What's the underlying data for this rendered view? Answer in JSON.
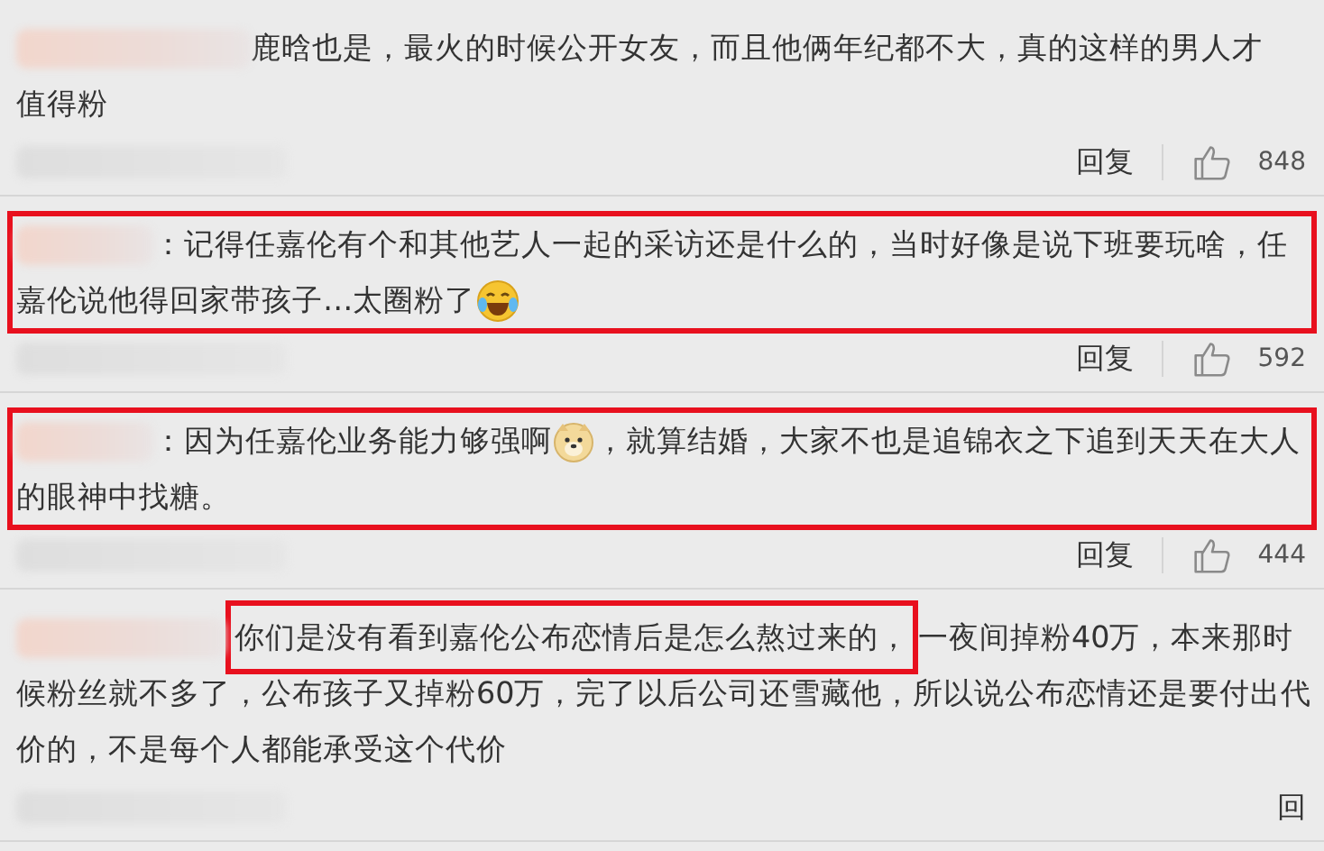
{
  "comments": [
    {
      "highlighted": false,
      "lines": [
        [
          {
            "kind": "text",
            "text": "鹿晗也是，最火的时候公开女友，而且他俩年纪都不大，真的这样的男人才",
            "highlighted": false
          }
        ],
        [
          {
            "kind": "text",
            "text": "值得粉",
            "highlighted": false
          }
        ]
      ],
      "reply": "回复",
      "likes": "848"
    },
    {
      "highlighted": true,
      "lines": [
        [
          {
            "kind": "text",
            "text": "：记得任嘉伦有个和其他艺人一起的采访还是什么的，当时好像是说下班要玩啥，任",
            "highlighted": false
          }
        ],
        [
          {
            "kind": "text",
            "text": "嘉伦说他得回家带孩子…太圈粉了",
            "highlighted": false
          },
          {
            "kind": "laughemoji"
          }
        ]
      ],
      "reply": "回复",
      "likes": "592"
    },
    {
      "highlighted": true,
      "lines": [
        [
          {
            "kind": "text",
            "text": "：因为任嘉伦业务能力够强啊",
            "highlighted": false
          },
          {
            "kind": "dogemoji"
          },
          {
            "kind": "text",
            "text": "，就算结婚，大家不也是追锦衣之下追到天天在大人",
            "highlighted": false
          }
        ],
        [
          {
            "kind": "text",
            "text": "的眼神中找糖。",
            "highlighted": false
          }
        ]
      ],
      "reply": "回复",
      "likes": "444"
    },
    {
      "highlighted": false,
      "lines": [
        [
          {
            "kind": "text",
            "text": "你们是没有看到嘉伦公布恋情后是怎么熬过来的，",
            "highlighted": true
          },
          {
            "kind": "text",
            "text": "一夜间掉粉40万，本来那时",
            "highlighted": false
          }
        ],
        [
          {
            "kind": "text",
            "text": "候粉丝就不多了，公布孩子又掉粉60万，完了以后公司还雪藏他，所以说公布恋情还是要付出代",
            "highlighted": false
          }
        ],
        [
          {
            "kind": "text",
            "text": "价的，不是每个人都能承受这个代价",
            "highlighted": false
          }
        ]
      ],
      "reply": "回"
    }
  ]
}
